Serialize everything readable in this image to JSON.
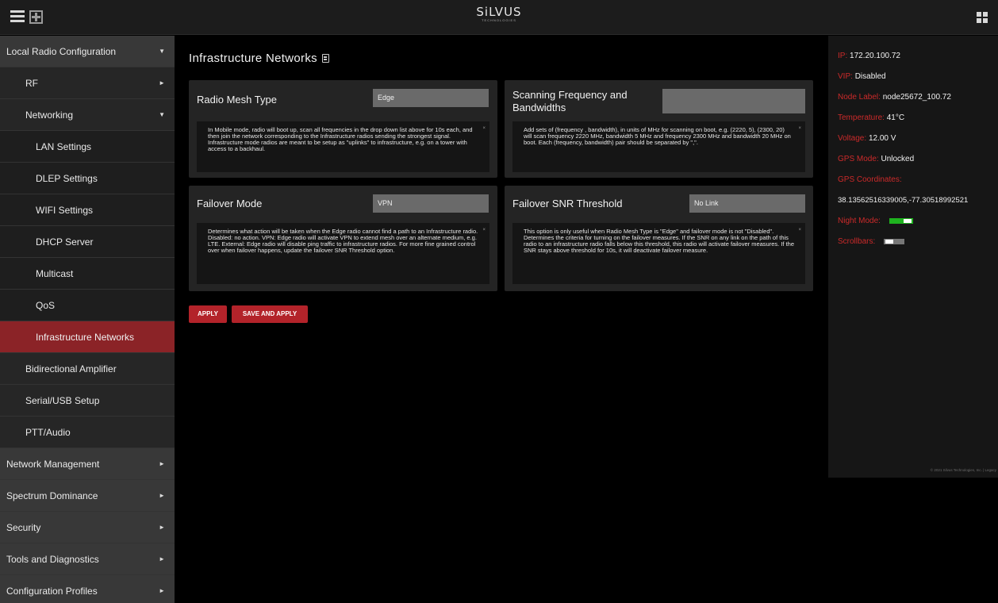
{
  "header": {
    "logo_text": "SiLVUS",
    "logo_subtext": "TECHNOLOGIES"
  },
  "sidebar": {
    "items": [
      {
        "label": "Local Radio Configuration",
        "level": "top",
        "arrow": "▼"
      },
      {
        "label": "RF",
        "level": "l2",
        "arrow": "►"
      },
      {
        "label": "Networking",
        "level": "l2",
        "arrow": "▼"
      },
      {
        "label": "LAN Settings",
        "level": "l3",
        "arrow": ""
      },
      {
        "label": "DLEP Settings",
        "level": "l3",
        "arrow": ""
      },
      {
        "label": "WIFI Settings",
        "level": "l3",
        "arrow": ""
      },
      {
        "label": "DHCP Server",
        "level": "l3",
        "arrow": ""
      },
      {
        "label": "Multicast",
        "level": "l3",
        "arrow": ""
      },
      {
        "label": "QoS",
        "level": "l3",
        "arrow": ""
      },
      {
        "label": "Infrastructure Networks",
        "level": "l3",
        "arrow": "",
        "active": true
      },
      {
        "label": "Bidirectional Amplifier",
        "level": "l2",
        "arrow": ""
      },
      {
        "label": "Serial/USB Setup",
        "level": "l2",
        "arrow": ""
      },
      {
        "label": "PTT/Audio",
        "level": "l2",
        "arrow": ""
      },
      {
        "label": "Network Management",
        "level": "top",
        "arrow": "►"
      },
      {
        "label": "Spectrum Dominance",
        "level": "top",
        "arrow": "►"
      },
      {
        "label": "Security",
        "level": "top",
        "arrow": "►"
      },
      {
        "label": "Tools and Diagnostics",
        "level": "top",
        "arrow": "►"
      },
      {
        "label": "Configuration Profiles",
        "level": "top",
        "arrow": "►"
      }
    ]
  },
  "main": {
    "title": "Infrastructure Networks",
    "cards": {
      "mesh_type": {
        "label": "Radio Mesh Type",
        "value": "Edge",
        "help": "In Mobile mode, radio will boot up, scan all frequencies in the drop down list above for 10s each, and then join the network corresponding to the Infrastructure radios sending the strongest signal. Infrastructure mode radios are meant to be setup as \"uplinks\" to infrastructure, e.g. on a tower with access to a backhaul."
      },
      "scan_freq": {
        "label": "Scanning Frequency and Bandwidths",
        "value": "",
        "help": "Add sets of (frequency , bandwidth), in units of MHz for scanning on boot, e.g. (2220, 5), (2300, 20) will scan frequency 2220 MHz, bandwidth 5 MHz and frequency 2300 MHz and bandwidth 20 MHz on boot. Each (frequency, bandwidth) pair should be separated by \",\"."
      },
      "failover_mode": {
        "label": "Failover Mode",
        "value": "VPN",
        "help": "Determines what action will be taken when the Edge radio cannot find a path to an Infrastructure radio. Disabled: no action. VPN: Edge radio will activate VPN to extend mesh over an alternate medium, e.g. LTE. External: Edge radio will disable ping traffic to infrastructure radios. For more fine grained control over when failover happens, update the failover SNR Threshold option."
      },
      "failover_snr": {
        "label": "Failover SNR Threshold",
        "value": "No Link",
        "help": "This option is only useful when Radio Mesh Type is \"Edge\" and failover mode is not \"Disabled\". Determines the criteria for turning on the failover measures. If the SNR on any link on the path of this radio to an infrastructure radio falls below this threshold, this radio will activate failover measures. If the SNR stays above threshold for 10s, it will deactivate failover measure."
      }
    },
    "help_close": "×",
    "apply_label": "APPLY",
    "save_apply_label": "SAVE AND APPLY"
  },
  "status": {
    "ip_key": "IP:",
    "ip_val": "172.20.100.72",
    "vip_key": "VIP:",
    "vip_val": "Disabled",
    "node_key": "Node Label:",
    "node_val": "node25672_100.72",
    "temp_key": "Temperature:",
    "temp_val": "41°C",
    "volt_key": "Voltage:",
    "volt_val": "12.00 V",
    "gps_mode_key": "GPS Mode:",
    "gps_mode_val": "Unlocked",
    "gps_coord_key": "GPS Coordinates:",
    "gps_coord_val": "38.13562516339005,-77.30518992521",
    "night_key": "Night Mode:",
    "night_on": true,
    "scroll_key": "Scrollbars:",
    "scroll_on": false,
    "copyright": "© 2021 Silvus Technologies, Inc. | Legacy"
  },
  "colors": {
    "accent_red": "#b3232a",
    "active_nav": "#8b2327",
    "toggle_on": "#1fb31f",
    "toggle_off": "#777777"
  }
}
